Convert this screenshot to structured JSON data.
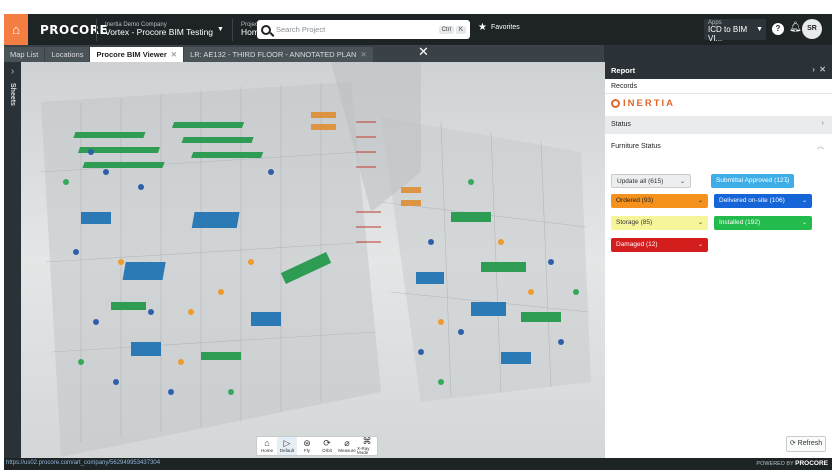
{
  "topbar": {
    "logo": "PROCORE",
    "company_small": "Inertia Demo Company",
    "company_big": "Vortex - Procore BIM Testing",
    "tools_small": "Project Tools",
    "tools_big": "Home",
    "search_placeholder": "Search Project",
    "kbd_ctrl": "Ctrl",
    "kbd_k": "K",
    "favorites": "Favorites",
    "apps_small": "Apps",
    "apps_big": "ICD to BIM VI...",
    "help": "?",
    "avatar": "SR"
  },
  "tabs": [
    {
      "label": "Map List"
    },
    {
      "label": "Locations"
    },
    {
      "label": "Procore BIM Viewer"
    },
    {
      "label": "LR: AE132 - THIRD FLOOR - ANNOTATED PLAN"
    }
  ],
  "sheets": {
    "label": "Sheets"
  },
  "toolbar3d": [
    {
      "label": "Home",
      "glyph": "⌂"
    },
    {
      "label": "Default",
      "glyph": "▷"
    },
    {
      "label": "Fly",
      "glyph": "⊛"
    },
    {
      "label": "Orbit",
      "glyph": "⟳"
    },
    {
      "label": "Measure",
      "glyph": "⌀"
    },
    {
      "label": "X-Ray Mode",
      "glyph": "⌘"
    }
  ],
  "report": {
    "title": "Report",
    "records": "Records",
    "brand": "INERTIA",
    "status_label": "Status",
    "furniture_label": "Furniture Status",
    "buttons": {
      "update_all": "Update all (615)",
      "submittal": "Submittal Approved (127)",
      "ordered": "Ordered (93)",
      "delivered": "Delivered on-site (106)",
      "storage": "Storage (85)",
      "installed": "Installed (192)",
      "damaged": "Damaged (12)"
    },
    "refresh": "Refresh"
  },
  "statusbar": {
    "url": "https://us02.procore.com/art_company/562949953437304",
    "powered_prefix": "POWERED BY",
    "powered_brand": "PROCORE"
  },
  "colors": {
    "brand_orange": "#f47e42",
    "inertia": "#e1672d",
    "submittal": "#3eaee8",
    "ordered": "#f5921e",
    "delivered": "#1565d8",
    "storage": "#f7f59a",
    "installed": "#22bb4c",
    "damaged": "#d41e1e"
  }
}
